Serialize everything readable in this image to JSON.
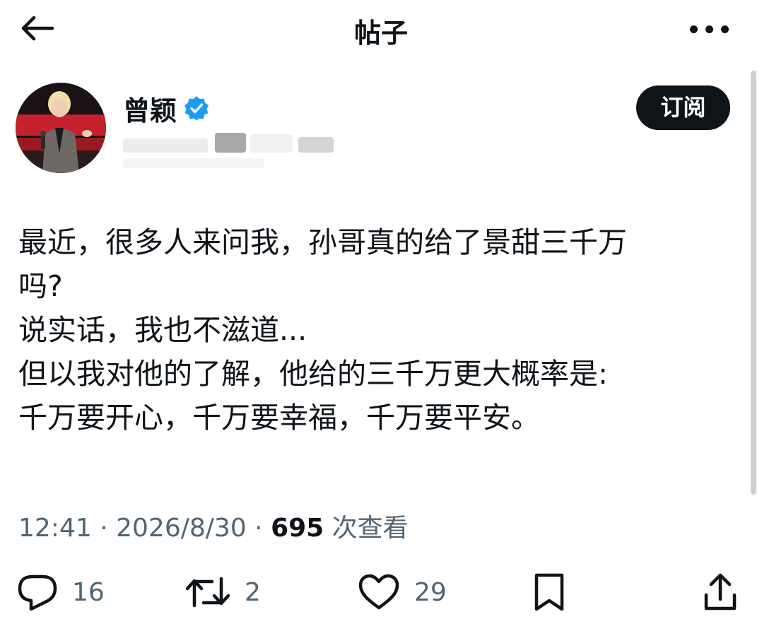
{
  "header": {
    "title": "帖子",
    "back_icon": "arrow-left-icon",
    "more_icon": "more-horizontal-icon"
  },
  "author": {
    "name": "曾颖",
    "verified_icon": "verified-badge-icon",
    "subscribe_label": "订阅"
  },
  "post": {
    "lines": [
      "最近，很多人来问我，孙哥真的给了景甜三千万",
      "吗?",
      "说实话，我也不滋道...",
      "但以我对他的了解，他给的三千万更大概率是:",
      "千万要开心，千万要幸福，千万要平安。"
    ],
    "time": "12:41",
    "separator": "·",
    "date": "2026/8/30",
    "views": "695",
    "views_label": "次查看"
  },
  "actions": {
    "reply_count": "16",
    "retweet_count": "2",
    "like_count": "29"
  },
  "colors": {
    "text": "#0f1419",
    "secondary": "#536471",
    "verified": "#1d9bf0",
    "button_bg": "#0f1419"
  }
}
